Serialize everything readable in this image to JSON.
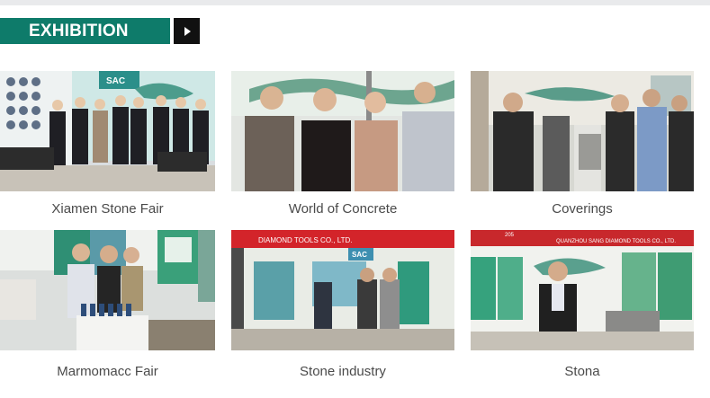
{
  "header": {
    "title": "EXHIBITION",
    "more_icon": "play-arrow-icon"
  },
  "exhibitions": [
    {
      "caption": "Xiamen Stone Fair",
      "booth_sign": "SAC"
    },
    {
      "caption": "World of Concrete"
    },
    {
      "caption": "Coverings"
    },
    {
      "caption": "Marmomacc Fair"
    },
    {
      "caption": "Stone industry",
      "banner_text": "DIAMOND TOOLS CO., LTD.",
      "booth_sign": "SAC"
    },
    {
      "caption": "Stona",
      "banner_text": "QUANZHOU SANG DIAMOND TOOLS CO., LTD.",
      "booth_number": "205"
    }
  ],
  "colors": {
    "accent": "#0e7b6a",
    "dark": "#111111"
  }
}
